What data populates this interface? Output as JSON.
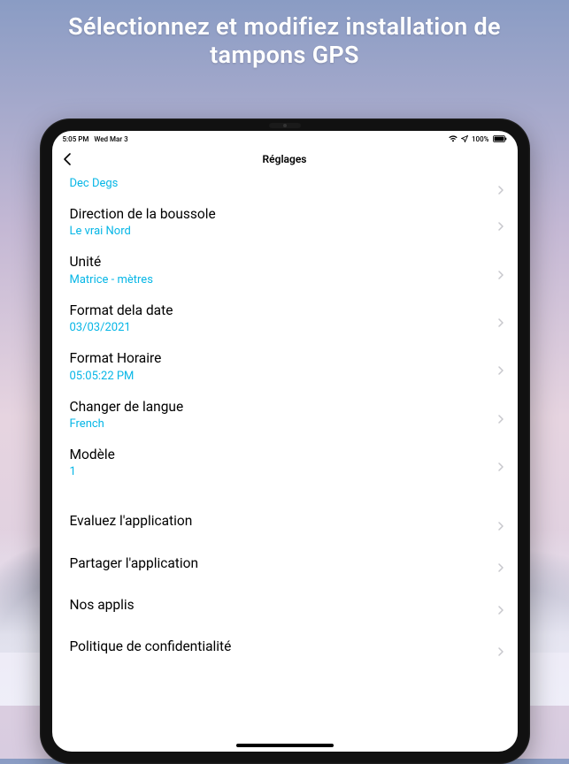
{
  "promo": {
    "headline": "Sélectionnez et modifiez installation de tampons GPS"
  },
  "statusbar": {
    "time": "5:05 PM",
    "date": "Wed Mar 3",
    "battery": "100%"
  },
  "navbar": {
    "title": "Réglages"
  },
  "settings": {
    "coord_format": {
      "title": "",
      "value": "Dec Degs"
    },
    "compass": {
      "title": "Direction de la boussole",
      "value": "Le vrai Nord"
    },
    "unit": {
      "title": "Unité",
      "value": "Matrice - mètres"
    },
    "date_format": {
      "title": "Format dela date",
      "value": "03/03/2021"
    },
    "time_format": {
      "title": "Format Horaire",
      "value": "05:05:22 PM"
    },
    "language": {
      "title": "Changer de langue",
      "value": "French"
    },
    "template": {
      "title": "Modèle",
      "value": "1"
    },
    "rate": {
      "title": "Evaluez l'application"
    },
    "share": {
      "title": "Partager l'application"
    },
    "our_apps": {
      "title": "Nos applis"
    },
    "privacy": {
      "title": "Politique de confidentialité"
    }
  },
  "colors": {
    "accent": "#06b6e6"
  }
}
